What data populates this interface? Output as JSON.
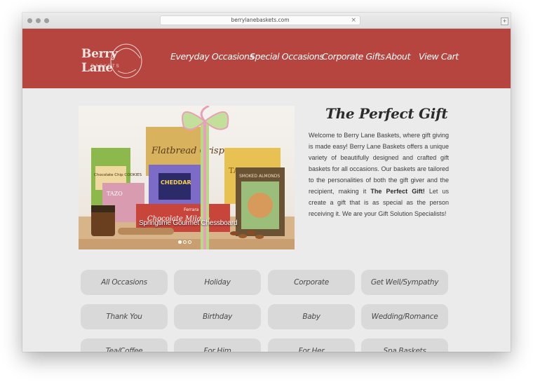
{
  "browser": {
    "url": "berrylanebaskets.com",
    "close_glyph": "×",
    "new_tab_glyph": "+"
  },
  "site": {
    "logo_name": "Berry Lane",
    "logo_tagline": "BASKETS",
    "nav": [
      "Everyday Occasions",
      "Special Occasions",
      "Corporate Gifts",
      "About",
      "View Cart"
    ]
  },
  "hero": {
    "caption": "Springtime Gourmet Chessboard",
    "product_labels": [
      "Flatbread Crisps",
      "CHEDDAR",
      "Chocolate Chip COOKIES",
      "SMOKED ALMONDS",
      "Chocolate Milano",
      "Ferrara",
      "TAZO"
    ],
    "slides": 3,
    "active_slide": 1
  },
  "intro": {
    "title": "The Perfect Gift",
    "paragraph_start": "Welcome to Berry Lane Baskets, where gift giving is made easy! Berry Lane Baskets offers a unique variety of beautifully designed and crafted gift baskets for all occasions. Our baskets are tailored to the personalities of both the gift giver and the recipient, making it ",
    "paragraph_bold": "The Perfect Gift!",
    "paragraph_end": " Let us create a gift that is as special as the person receiving it. We are your Gift Solution Specialists!"
  },
  "categories": [
    "All Occasions",
    "Holiday",
    "Corporate",
    "Get Well/Sympathy",
    "Thank You",
    "Birthday",
    "Baby",
    "Wedding/Romance",
    "Tea/Coffee",
    "For Him",
    "For Her",
    "Spa Baskets"
  ],
  "colors": {
    "header": "#b64540",
    "page_bg": "#ebebeb",
    "button_bg": "#d9d9d9"
  }
}
